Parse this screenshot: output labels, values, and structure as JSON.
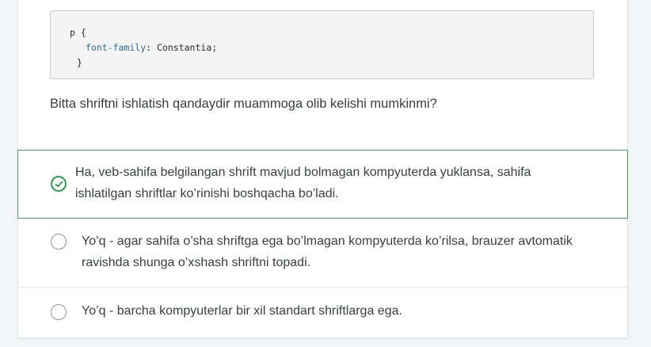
{
  "code": {
    "selector_line": "p {",
    "property": "font-family",
    "value_line": ": Constantia;",
    "closing": "}"
  },
  "question": "Bitta shriftni ishlatish qandaydir muammoga olib kelishi mumkinmi?",
  "options": [
    {
      "text": "Ha, veb-sahifa belgilangan shrift mavjud bolmagan kompyuterda yuklansa, sahifa ishlatilgan shriftlar ko’rinishi boshqacha bo’ladi.",
      "state": "correct-selected",
      "icon": "check-circle-icon"
    },
    {
      "text": "Yo’q - agar sahifa o’sha shriftga ega bo’lmagan kompyuterda ko’rilsa, brauzer avtomatik ravishda shunga o’xshash shriftni topadi.",
      "state": "unselected",
      "icon": "radio-empty-icon"
    },
    {
      "text": "Yo’q - barcha kompyuterlar bir xil standart shriftlarga ega.",
      "state": "unselected",
      "icon": "radio-empty-icon"
    }
  ],
  "colors": {
    "correct": "#3fa35a",
    "code_property": "#2a6f8f",
    "text": "#3b3d40"
  }
}
